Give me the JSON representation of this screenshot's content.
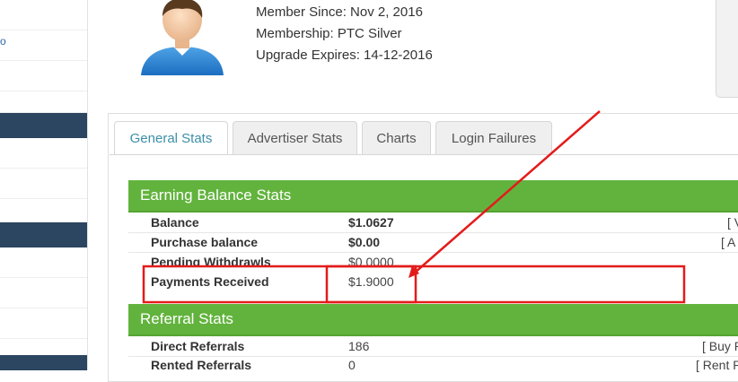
{
  "profile": {
    "member_since": "Member Since: Nov 2, 2016",
    "membership": "Membership: PTC Silver",
    "upgrade_expires": "Upgrade Expires: 14-12-2016"
  },
  "sidebar": {
    "partial_glyph": "o"
  },
  "tabs": [
    {
      "label": "General Stats",
      "active": true
    },
    {
      "label": "Advertiser Stats",
      "active": false
    },
    {
      "label": "Charts",
      "active": false
    },
    {
      "label": "Login Failures",
      "active": false
    }
  ],
  "earning": {
    "title": "Earning Balance Stats",
    "rows": [
      {
        "label": "Balance",
        "value": "$1.0627",
        "action": "[ V"
      },
      {
        "label": "Purchase balance",
        "value": "$0.00",
        "action": "[ A"
      },
      {
        "label": "Pending Withdrawls",
        "value": "$0.0000",
        "action": ""
      },
      {
        "label": "Payments Received",
        "value": "$1.9000",
        "action": ""
      }
    ]
  },
  "referral": {
    "title": "Referral Stats",
    "rows": [
      {
        "label": "Direct Referrals",
        "value": "186",
        "action": "[ Buy R"
      },
      {
        "label": "Rented Referrals",
        "value": "0",
        "action": "[ Rent R"
      }
    ]
  },
  "colors": {
    "section_green": "#62b33d",
    "annotation_red": "#e31b1b",
    "active_tab_text": "#3d8fa8",
    "sidebar_dark": "#2c4560"
  }
}
